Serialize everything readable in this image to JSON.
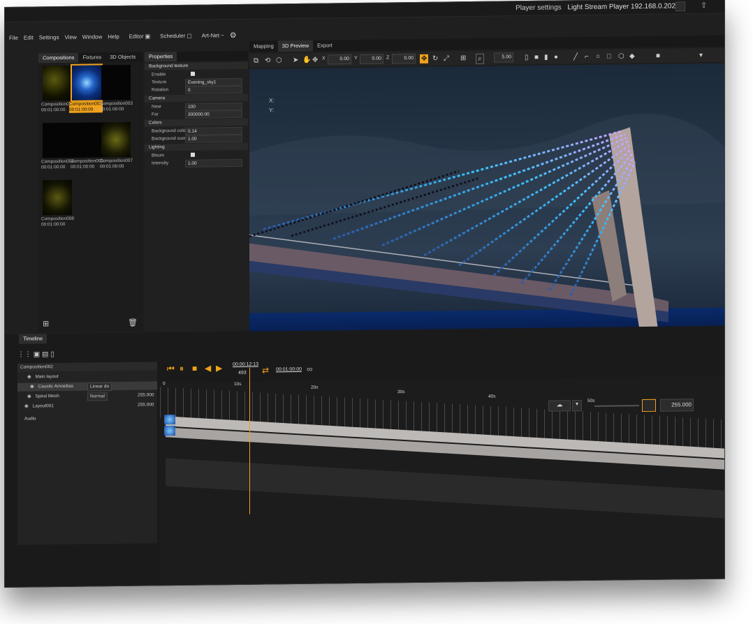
{
  "title_bar": {
    "player_settings_label": "Player settings",
    "player_name": "Light Stream Player 192.168.0.202"
  },
  "menu": {
    "items": [
      "File",
      "Edit",
      "Settings",
      "View",
      "Window",
      "Help"
    ],
    "editor": "Editor",
    "scheduler": "Scheduler",
    "artnet": "Art-Net"
  },
  "left_panel": {
    "tabs": [
      "Compositions",
      "Fixtures",
      "3D Objects"
    ],
    "compositions": [
      {
        "name": "Composition001",
        "time": "00:01:00:00"
      },
      {
        "name": "Composition002",
        "time": "00:01:00:00",
        "selected": true
      },
      {
        "name": "Composition003",
        "time": "00:01:00:00"
      },
      {
        "name": "Composition004",
        "time": "00:01:00:00"
      },
      {
        "name": "Composition005",
        "time": "00:01:00:00"
      },
      {
        "name": "Composition007",
        "time": "00:01:00:00"
      },
      {
        "name": "Composition008",
        "time": "00:01:00:00"
      }
    ]
  },
  "properties": {
    "tab": "Properties",
    "background_texture": {
      "header": "Background texture",
      "enable_label": "Enable",
      "texture_label": "Texture",
      "texture_value": "Evening_sky1",
      "rotation_label": "Rotation",
      "rotation_value": "0"
    },
    "camera": {
      "header": "Camera",
      "near_label": "Near",
      "near_value": "100",
      "far_label": "Far",
      "far_value": "300000.00"
    },
    "colors": {
      "header": "Colors",
      "bg_color_label": "Background color",
      "bg_color_value": "0.14",
      "bg_scene_label": "Background scene o...",
      "bg_scene_value": "1.00"
    },
    "lighting": {
      "header": "Lighting",
      "bloom_label": "Bloom",
      "intensity_label": "Intensity",
      "intensity_value": "1.00"
    }
  },
  "viewport": {
    "tabs": [
      "Mapping",
      "3D Preview",
      "Export"
    ],
    "x_value": "0.00",
    "y_value": "0.00",
    "z_value": "0.00",
    "zoom_value": "5.00",
    "coord_x": "X:",
    "coord_y": "Y:"
  },
  "timeline": {
    "tab": "Timeline",
    "composition": "Composition002",
    "current_time": "00:00:12:13",
    "frame": "493",
    "duration": "00:01:00:00",
    "layers": [
      {
        "name": "Main layout"
      },
      {
        "name": "Caustic Amoebas",
        "blend": "Linear do"
      },
      {
        "name": "Spiral Mesh",
        "blend": "Normal",
        "value": "255.000"
      },
      {
        "name": "Layout001",
        "value": "255.000"
      }
    ],
    "audio_label": "Audio",
    "ruler_labels": [
      "0",
      "10s",
      "20s",
      "30s",
      "40s",
      "50s"
    ],
    "master_value": "255.000"
  },
  "colors": {
    "accent": "#f0a21c",
    "bg": "#1f1f1f"
  }
}
